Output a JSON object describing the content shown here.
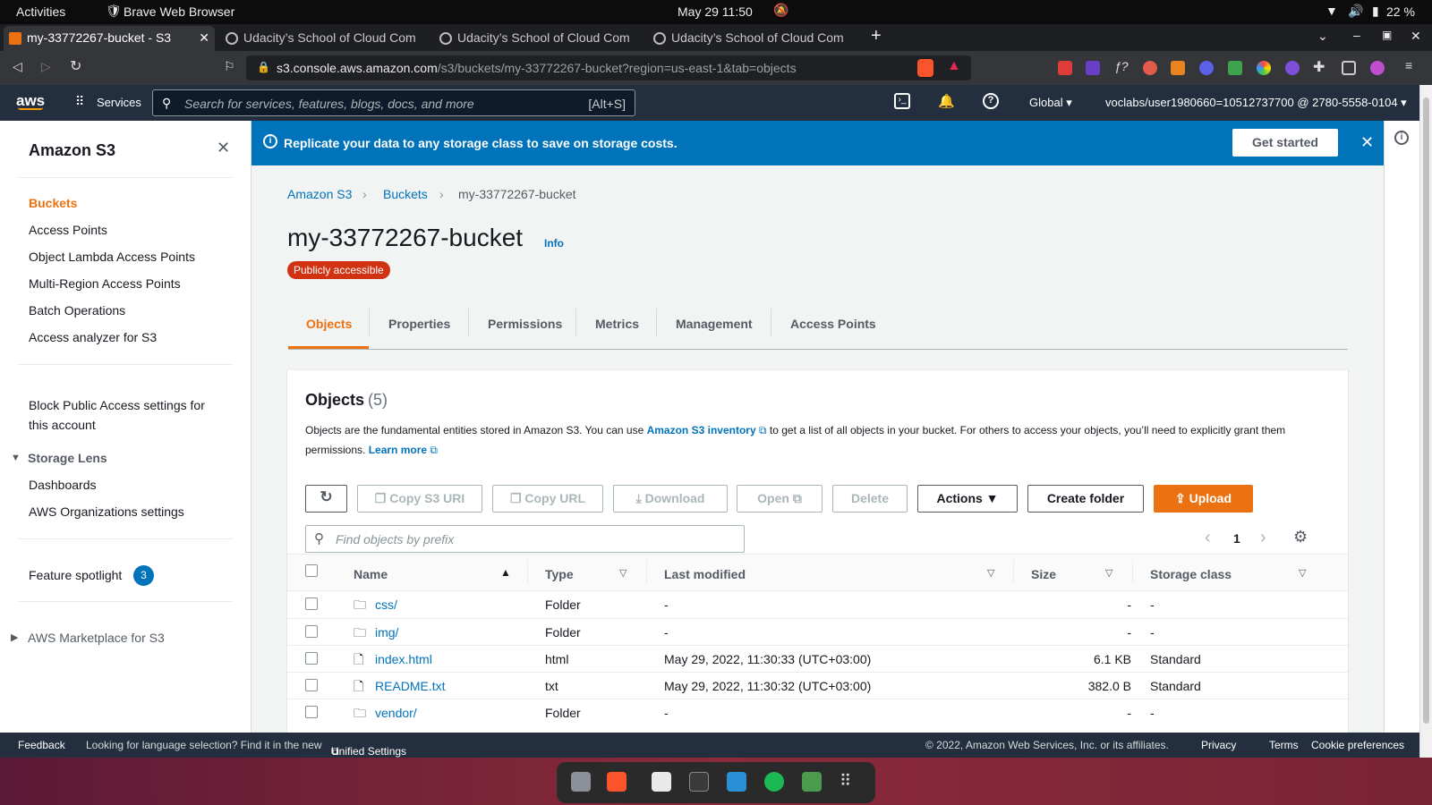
{
  "system": {
    "activities": "Activities",
    "app": "Brave Web Browser",
    "datetime": "May 29  11:50",
    "battery": "22 %"
  },
  "tabs": [
    {
      "label": "my-33772267-bucket - S3"
    },
    {
      "label": "Udacity’s School of Cloud Com"
    },
    {
      "label": "Udacity’s School of Cloud Com"
    },
    {
      "label": "Udacity’s School of Cloud Com"
    }
  ],
  "address": {
    "host": "s3.console.aws.amazon.com",
    "path": "/s3/buckets/my-33772267-bucket?region=us-east-1&tab=objects"
  },
  "aws_header": {
    "logo": "aws",
    "services": "Services",
    "search_placeholder": "Search for services, features, blogs, docs, and more",
    "shortcut": "[Alt+S]",
    "region": "Global",
    "account": "voclabs/user1980660=10512737700 @ 2780-5558-0104"
  },
  "sidebar": {
    "title": "Amazon S3",
    "items": [
      "Buckets",
      "Access Points",
      "Object Lambda Access Points",
      "Multi-Region Access Points",
      "Batch Operations",
      "Access analyzer for S3"
    ],
    "block_public_1": "Block Public Access settings for",
    "block_public_2": "this account",
    "storage_lens": "Storage Lens",
    "storage_lens_items": [
      "Dashboards",
      "AWS Organizations settings"
    ],
    "feature_spotlight": "Feature spotlight",
    "feature_count": "3",
    "marketplace": "AWS Marketplace for S3"
  },
  "banner": {
    "text": "Replicate your data to any storage class to save on storage costs.",
    "button": "Get started"
  },
  "breadcrumb": [
    "Amazon S3",
    "Buckets",
    "my-33772267-bucket"
  ],
  "bucket": {
    "name": "my-33772267-bucket",
    "info": "Info",
    "badge": "Publicly accessible"
  },
  "bucket_tabs": [
    "Objects",
    "Properties",
    "Permissions",
    "Metrics",
    "Management",
    "Access Points"
  ],
  "objects": {
    "title": "Objects",
    "count": "(5)",
    "desc_1": "Objects are the fundamental entities stored in Amazon S3. You can use",
    "inventory_link": "Amazon S3 inventory",
    "desc_2": "to get a list of all objects in your bucket. For others to access your objects, you’ll need to explicitly grant them",
    "desc_3": "permissions.",
    "learn_more": "Learn more",
    "buttons": {
      "copy_uri": "Copy S3 URI",
      "copy_url": "Copy URL",
      "download": "Download",
      "open": "Open",
      "delete": "Delete",
      "actions": "Actions",
      "create_folder": "Create folder",
      "upload": "Upload"
    },
    "filter_placeholder": "Find objects by prefix",
    "page": "1",
    "columns": [
      "Name",
      "Type",
      "Last modified",
      "Size",
      "Storage class"
    ],
    "rows": [
      {
        "name": "css/",
        "type": "Folder",
        "modified": "-",
        "size": "-",
        "storage": "-"
      },
      {
        "name": "img/",
        "type": "Folder",
        "modified": "-",
        "size": "-",
        "storage": "-"
      },
      {
        "name": "index.html",
        "type": "html",
        "modified": "May 29, 2022, 11:30:33 (UTC+03:00)",
        "size": "6.1 KB",
        "storage": "Standard"
      },
      {
        "name": "README.txt",
        "type": "txt",
        "modified": "May 29, 2022, 11:30:32 (UTC+03:00)",
        "size": "382.0 B",
        "storage": "Standard"
      },
      {
        "name": "vendor/",
        "type": "Folder",
        "modified": "-",
        "size": "-",
        "storage": "-"
      }
    ]
  },
  "footer": {
    "feedback": "Feedback",
    "lang_prompt": "Looking for language selection? Find it in the new",
    "unified": "Unified Settings",
    "copyright": "© 2022, Amazon Web Services, Inc. or its affiliates.",
    "privacy": "Privacy",
    "terms": "Terms",
    "cookies": "Cookie preferences"
  },
  "colors": {
    "aws_nav": "#232f3e",
    "link": "#0073bb",
    "orange": "#ec7211",
    "badge_red": "#d13212",
    "banner": "#0073bb"
  }
}
